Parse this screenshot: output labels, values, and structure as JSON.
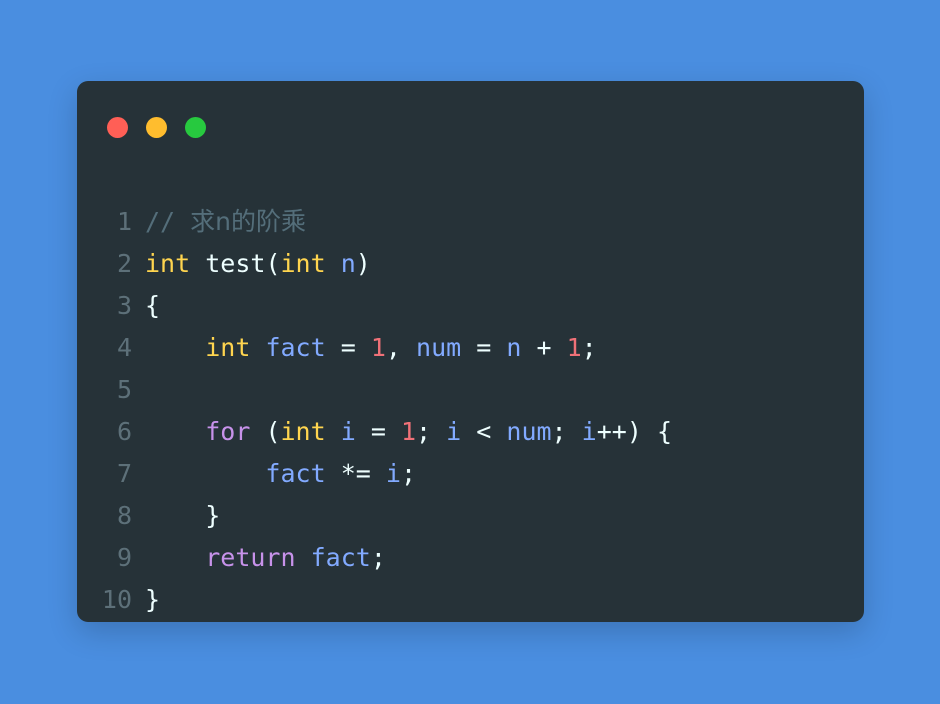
{
  "page": {
    "background_color": "#4a8ee0",
    "card_background_color": "#263238"
  },
  "window_controls": {
    "close": {
      "name": "close",
      "color": "#ff5f56"
    },
    "minimize": {
      "name": "minimize",
      "color": "#ffbd2e"
    },
    "maximize": {
      "name": "maximize",
      "color": "#27c93f"
    }
  },
  "theme": {
    "comment": "#546e7a",
    "type": "#ffd54f",
    "keyword": "#c792ea",
    "variable": "#82aaff",
    "number": "#f07178",
    "plain": "#eeffff",
    "line_number": "#5d7079"
  },
  "editor": {
    "language": "C",
    "line_numbers": [
      "1",
      "2",
      "3",
      "4",
      "5",
      "6",
      "7",
      "8",
      "9",
      "10"
    ],
    "lines": [
      {
        "number": "1",
        "text": "// 求n的阶乘",
        "tokens": [
          {
            "text": "// ",
            "type": "comment"
          },
          {
            "text": "求n的阶乘",
            "type": "comment-cjk"
          }
        ]
      },
      {
        "number": "2",
        "text": "int test(int n)",
        "tokens": [
          {
            "text": "int",
            "type": "type"
          },
          {
            "text": " ",
            "type": "plain"
          },
          {
            "text": "test",
            "type": "fn"
          },
          {
            "text": "(",
            "type": "punct"
          },
          {
            "text": "int",
            "type": "type"
          },
          {
            "text": " ",
            "type": "plain"
          },
          {
            "text": "n",
            "type": "var"
          },
          {
            "text": ")",
            "type": "punct"
          }
        ]
      },
      {
        "number": "3",
        "text": "{",
        "tokens": [
          {
            "text": "{",
            "type": "punct"
          }
        ]
      },
      {
        "number": "4",
        "text": "    int fact = 1, num = n + 1;",
        "tokens": [
          {
            "text": "    ",
            "type": "plain"
          },
          {
            "text": "int",
            "type": "type"
          },
          {
            "text": " ",
            "type": "plain"
          },
          {
            "text": "fact",
            "type": "var"
          },
          {
            "text": " ",
            "type": "plain"
          },
          {
            "text": "=",
            "type": "op"
          },
          {
            "text": " ",
            "type": "plain"
          },
          {
            "text": "1",
            "type": "number"
          },
          {
            "text": ", ",
            "type": "punct"
          },
          {
            "text": "num",
            "type": "var"
          },
          {
            "text": " ",
            "type": "plain"
          },
          {
            "text": "=",
            "type": "op"
          },
          {
            "text": " ",
            "type": "plain"
          },
          {
            "text": "n",
            "type": "var"
          },
          {
            "text": " ",
            "type": "plain"
          },
          {
            "text": "+",
            "type": "op"
          },
          {
            "text": " ",
            "type": "plain"
          },
          {
            "text": "1",
            "type": "number"
          },
          {
            "text": ";",
            "type": "punct"
          }
        ]
      },
      {
        "number": "5",
        "text": "",
        "tokens": []
      },
      {
        "number": "6",
        "text": "    for (int i = 1; i < num; i++) {",
        "tokens": [
          {
            "text": "    ",
            "type": "plain"
          },
          {
            "text": "for",
            "type": "keyword"
          },
          {
            "text": " ",
            "type": "plain"
          },
          {
            "text": "(",
            "type": "punct"
          },
          {
            "text": "int",
            "type": "type"
          },
          {
            "text": " ",
            "type": "plain"
          },
          {
            "text": "i",
            "type": "var"
          },
          {
            "text": " ",
            "type": "plain"
          },
          {
            "text": "=",
            "type": "op"
          },
          {
            "text": " ",
            "type": "plain"
          },
          {
            "text": "1",
            "type": "number"
          },
          {
            "text": "; ",
            "type": "punct"
          },
          {
            "text": "i",
            "type": "var"
          },
          {
            "text": " ",
            "type": "plain"
          },
          {
            "text": "<",
            "type": "op"
          },
          {
            "text": " ",
            "type": "plain"
          },
          {
            "text": "num",
            "type": "var"
          },
          {
            "text": "; ",
            "type": "punct"
          },
          {
            "text": "i",
            "type": "var"
          },
          {
            "text": "++",
            "type": "op"
          },
          {
            "text": ")",
            "type": "punct"
          },
          {
            "text": " ",
            "type": "plain"
          },
          {
            "text": "{",
            "type": "punct"
          }
        ]
      },
      {
        "number": "7",
        "text": "        fact *= i;",
        "tokens": [
          {
            "text": "        ",
            "type": "plain"
          },
          {
            "text": "fact",
            "type": "var"
          },
          {
            "text": " ",
            "type": "plain"
          },
          {
            "text": "*=",
            "type": "op"
          },
          {
            "text": " ",
            "type": "plain"
          },
          {
            "text": "i",
            "type": "var"
          },
          {
            "text": ";",
            "type": "punct"
          }
        ]
      },
      {
        "number": "8",
        "text": "    }",
        "tokens": [
          {
            "text": "    ",
            "type": "plain"
          },
          {
            "text": "}",
            "type": "punct"
          }
        ]
      },
      {
        "number": "9",
        "text": "    return fact;",
        "tokens": [
          {
            "text": "    ",
            "type": "plain"
          },
          {
            "text": "return",
            "type": "keyword"
          },
          {
            "text": " ",
            "type": "plain"
          },
          {
            "text": "fact",
            "type": "var"
          },
          {
            "text": ";",
            "type": "punct"
          }
        ]
      },
      {
        "number": "10",
        "text": "}",
        "tokens": [
          {
            "text": "}",
            "type": "punct"
          }
        ]
      }
    ]
  }
}
